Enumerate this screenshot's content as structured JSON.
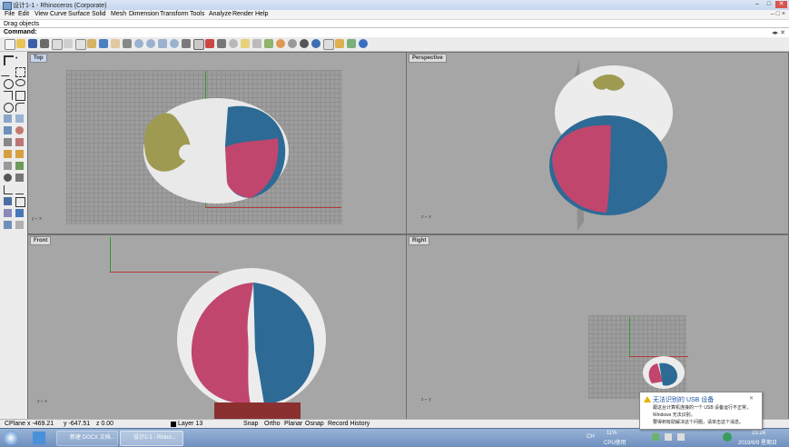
{
  "window": {
    "title": "设计1-1 - Rhinoceros (Corporate)"
  },
  "menu": {
    "items": [
      "File",
      "Edit",
      "View",
      "Curve",
      "Surface",
      "Solid",
      "Mesh",
      "Dimension",
      "Transform",
      "Tools",
      "Analyze",
      "Render",
      "Help"
    ]
  },
  "command": {
    "history": "Drag objects",
    "label": "Command:",
    "value": ""
  },
  "viewports": [
    {
      "name": "Top"
    },
    {
      "name": "Perspective"
    },
    {
      "name": "Front"
    },
    {
      "name": "Right"
    }
  ],
  "status": {
    "cplane": "CPlane",
    "x": "x -469.21",
    "y": "y -647.51",
    "z": "z 0.00",
    "layer": "Layer 13",
    "toggles": [
      "Snap",
      "Ortho",
      "Planar",
      "Osnap",
      "Record History"
    ]
  },
  "taskbar": {
    "buttons": [
      "新建 DOCX 文档...",
      "设计1-1 - Rhino..."
    ],
    "cpu_label": "CPU使用",
    "cpu_value": "11%",
    "lang": "CH",
    "time": "23:26",
    "date": "2019/6/9 星期日"
  },
  "notification": {
    "title": "无法识别的 USB 设备",
    "body": [
      "跟这台计算机连接的一个 USB 设备运行不正常，",
      "Windows 无法识别。",
      "要得到有助解决这个问题，请单击这个消息。"
    ]
  },
  "colors": {
    "accent": "#c4d6ee",
    "pink": "#c0466e",
    "blue": "#2d6a95",
    "olive": "#9e9a52"
  }
}
